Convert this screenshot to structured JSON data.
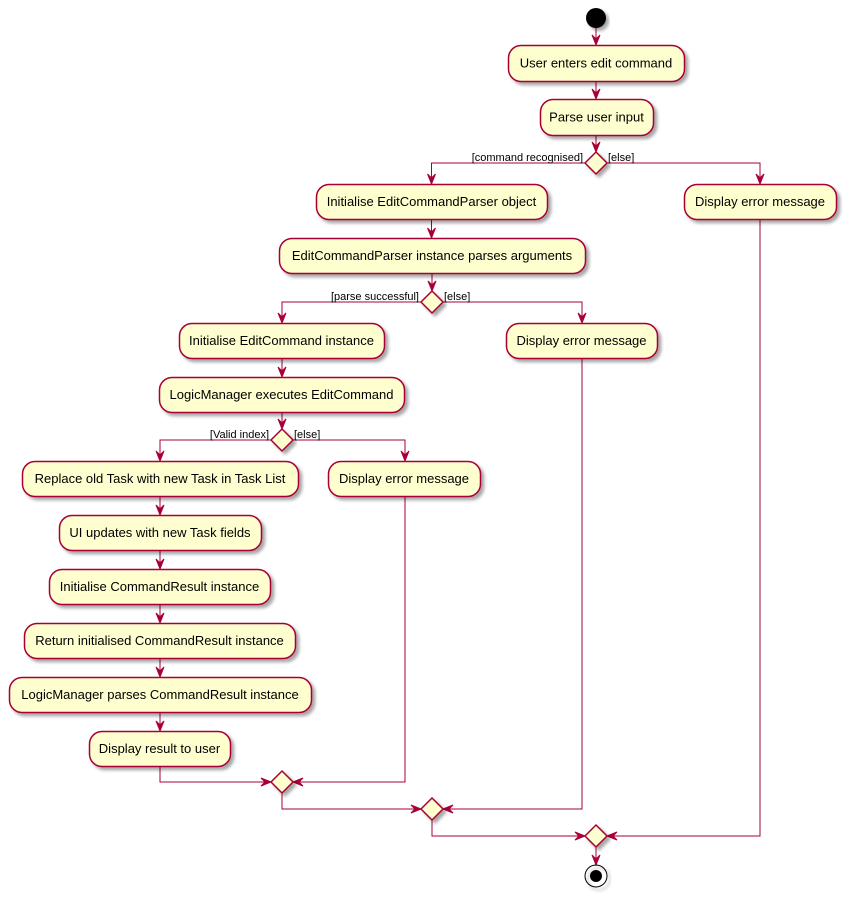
{
  "diagram": {
    "type": "activity",
    "colors": {
      "node_fill": "#FEFECE",
      "node_border": "#A80036",
      "edge": "#A80036",
      "start_end": "#000000",
      "shadow": "#b8b8b8"
    },
    "start": {
      "name": "start-node"
    },
    "end": {
      "name": "end-node"
    },
    "activities": [
      {
        "id": "a1",
        "label": "User enters edit command"
      },
      {
        "id": "a2",
        "label": "Parse user input"
      },
      {
        "id": "a3",
        "label": "Initialise EditCommandParser object"
      },
      {
        "id": "a4",
        "label": "Display error message"
      },
      {
        "id": "a5",
        "label": "EditCommandParser instance parses arguments"
      },
      {
        "id": "a6",
        "label": "Initialise EditCommand instance"
      },
      {
        "id": "a7",
        "label": "Display error message"
      },
      {
        "id": "a8",
        "label": "LogicManager executes EditCommand"
      },
      {
        "id": "a9",
        "label": "Replace old Task with new Task in Task List"
      },
      {
        "id": "a10",
        "label": "Display error message"
      },
      {
        "id": "a11",
        "label": "UI updates with new Task fields"
      },
      {
        "id": "a12",
        "label": "Initialise CommandResult instance"
      },
      {
        "id": "a13",
        "label": "Return initialised CommandResult instance"
      },
      {
        "id": "a14",
        "label": "LogicManager parses CommandResult instance"
      },
      {
        "id": "a15",
        "label": "Display result to user"
      }
    ],
    "decisions": [
      {
        "id": "d1",
        "then_guard": "[command recognised]",
        "else_guard": "[else]"
      },
      {
        "id": "d2",
        "then_guard": "[parse successful]",
        "else_guard": "[else]"
      },
      {
        "id": "d3",
        "then_guard": "[Valid index]",
        "else_guard": "[else]"
      }
    ],
    "merges": [
      {
        "id": "m3"
      },
      {
        "id": "m2"
      },
      {
        "id": "m1"
      }
    ]
  }
}
